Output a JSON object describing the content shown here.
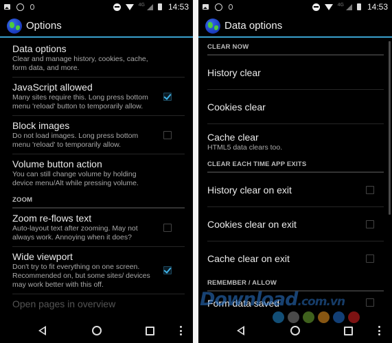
{
  "status_bar": {
    "network_label": "4G",
    "time": "14:53"
  },
  "left_screen": {
    "title": "Options",
    "items": [
      {
        "title": "Data options",
        "summary": "Clear and manage history, cookies, cache, form data, and more."
      },
      {
        "title": "JavaScript allowed",
        "summary": "Many sites require this. Long press bottom menu 'reload' button to temporarily allow.",
        "checked": true
      },
      {
        "title": "Block images",
        "summary": "Do not load images. Long press bottom menu 'reload' to temporarily allow.",
        "checked": false
      },
      {
        "title": "Volume button action",
        "summary": "You can still change volume by holding device menu/Alt while pressing volume."
      }
    ],
    "section_zoom": "ZOOM",
    "zoom_items": [
      {
        "title": "Zoom re-flows text",
        "summary": "Auto-layout text after zooming. May not always work. Annoying when it does?",
        "checked": false
      },
      {
        "title": "Wide viewport",
        "summary": "Don't try to fit everything on one screen. Recommended on, but some sites/ devices may work better with this off.",
        "checked": true
      },
      {
        "title": "Open pages in overview"
      }
    ]
  },
  "right_screen": {
    "title": "Data options",
    "section_clear_now": "CLEAR NOW",
    "clear_now": [
      {
        "title": "History clear"
      },
      {
        "title": "Cookies clear"
      },
      {
        "title": "Cache clear",
        "summary": "HTML5 data clears too."
      }
    ],
    "section_clear_exit": "CLEAR EACH TIME APP EXITS",
    "clear_exit": [
      {
        "title": "History clear on exit",
        "checked": false
      },
      {
        "title": "Cookies clear on exit",
        "checked": false
      },
      {
        "title": "Cache clear on exit",
        "checked": false
      }
    ],
    "section_remember": "REMEMBER / ALLOW",
    "remember": [
      {
        "title": "Form data saved",
        "checked": false
      }
    ]
  },
  "watermark": {
    "text": "Download",
    "domain": ".com.vn",
    "dot_colors": [
      "#1a6fa8",
      "#6a6a6a",
      "#5a8a2a",
      "#c07a1a",
      "#1a5aa8",
      "#b01a1a"
    ]
  },
  "colors": {
    "accent": "#3aa2cf",
    "background": "#000000"
  }
}
